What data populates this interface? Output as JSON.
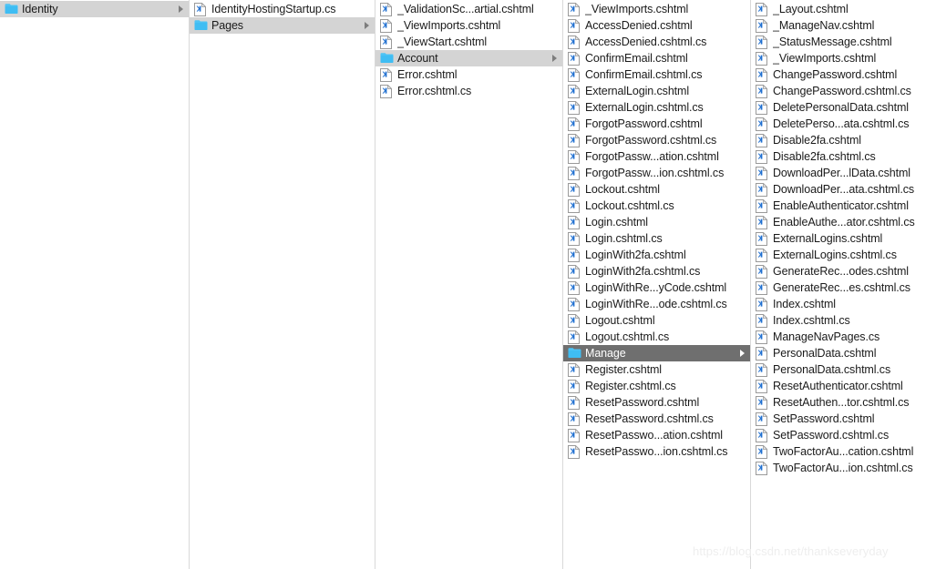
{
  "watermark": "https://blog.csdn.net/thankseveryday",
  "colors": {
    "selection_active_bg": "#6f6f6f",
    "selection_active_text": "#ffffff",
    "selection_inactive_bg": "#d4d4d4",
    "folder_icon": "#55c7f7",
    "file_icon_mark": "#1f6fd0",
    "column_divider": "#d9d9d9",
    "row_text": "#1a1a1a"
  },
  "columns": [
    {
      "name": "column-identity",
      "items": [
        {
          "label": "Identity",
          "icon": "folder-icon",
          "kind": "folder",
          "selected": "inactive",
          "disclosure": true
        }
      ]
    },
    {
      "name": "column-identity-contents",
      "items": [
        {
          "label": "IdentityHostingStartup.cs",
          "icon": "file-icon",
          "kind": "file",
          "selected": "none",
          "disclosure": false
        },
        {
          "label": "Pages",
          "icon": "folder-icon",
          "kind": "folder",
          "selected": "inactive",
          "disclosure": true
        }
      ]
    },
    {
      "name": "column-pages-contents",
      "items": [
        {
          "label": "_ValidationSc...artial.cshtml",
          "icon": "file-icon",
          "kind": "file",
          "selected": "none",
          "disclosure": false
        },
        {
          "label": "_ViewImports.cshtml",
          "icon": "file-icon",
          "kind": "file",
          "selected": "none",
          "disclosure": false
        },
        {
          "label": "_ViewStart.cshtml",
          "icon": "file-icon",
          "kind": "file",
          "selected": "none",
          "disclosure": false
        },
        {
          "label": "Account",
          "icon": "folder-icon",
          "kind": "folder",
          "selected": "inactive",
          "disclosure": true
        },
        {
          "label": "Error.cshtml",
          "icon": "file-icon",
          "kind": "file",
          "selected": "none",
          "disclosure": false
        },
        {
          "label": "Error.cshtml.cs",
          "icon": "file-icon",
          "kind": "file",
          "selected": "none",
          "disclosure": false
        }
      ]
    },
    {
      "name": "column-account-contents",
      "items": [
        {
          "label": "_ViewImports.cshtml",
          "icon": "file-icon",
          "kind": "file",
          "selected": "none",
          "disclosure": false
        },
        {
          "label": "AccessDenied.cshtml",
          "icon": "file-icon",
          "kind": "file",
          "selected": "none",
          "disclosure": false
        },
        {
          "label": "AccessDenied.cshtml.cs",
          "icon": "file-icon",
          "kind": "file",
          "selected": "none",
          "disclosure": false
        },
        {
          "label": "ConfirmEmail.cshtml",
          "icon": "file-icon",
          "kind": "file",
          "selected": "none",
          "disclosure": false
        },
        {
          "label": "ConfirmEmail.cshtml.cs",
          "icon": "file-icon",
          "kind": "file",
          "selected": "none",
          "disclosure": false
        },
        {
          "label": "ExternalLogin.cshtml",
          "icon": "file-icon",
          "kind": "file",
          "selected": "none",
          "disclosure": false
        },
        {
          "label": "ExternalLogin.cshtml.cs",
          "icon": "file-icon",
          "kind": "file",
          "selected": "none",
          "disclosure": false
        },
        {
          "label": "ForgotPassword.cshtml",
          "icon": "file-icon",
          "kind": "file",
          "selected": "none",
          "disclosure": false
        },
        {
          "label": "ForgotPassword.cshtml.cs",
          "icon": "file-icon",
          "kind": "file",
          "selected": "none",
          "disclosure": false
        },
        {
          "label": "ForgotPassw...ation.cshtml",
          "icon": "file-icon",
          "kind": "file",
          "selected": "none",
          "disclosure": false
        },
        {
          "label": "ForgotPassw...ion.cshtml.cs",
          "icon": "file-icon",
          "kind": "file",
          "selected": "none",
          "disclosure": false
        },
        {
          "label": "Lockout.cshtml",
          "icon": "file-icon",
          "kind": "file",
          "selected": "none",
          "disclosure": false
        },
        {
          "label": "Lockout.cshtml.cs",
          "icon": "file-icon",
          "kind": "file",
          "selected": "none",
          "disclosure": false
        },
        {
          "label": "Login.cshtml",
          "icon": "file-icon",
          "kind": "file",
          "selected": "none",
          "disclosure": false
        },
        {
          "label": "Login.cshtml.cs",
          "icon": "file-icon",
          "kind": "file",
          "selected": "none",
          "disclosure": false
        },
        {
          "label": "LoginWith2fa.cshtml",
          "icon": "file-icon",
          "kind": "file",
          "selected": "none",
          "disclosure": false
        },
        {
          "label": "LoginWith2fa.cshtml.cs",
          "icon": "file-icon",
          "kind": "file",
          "selected": "none",
          "disclosure": false
        },
        {
          "label": "LoginWithRe...yCode.cshtml",
          "icon": "file-icon",
          "kind": "file",
          "selected": "none",
          "disclosure": false
        },
        {
          "label": "LoginWithRe...ode.cshtml.cs",
          "icon": "file-icon",
          "kind": "file",
          "selected": "none",
          "disclosure": false
        },
        {
          "label": "Logout.cshtml",
          "icon": "file-icon",
          "kind": "file",
          "selected": "none",
          "disclosure": false
        },
        {
          "label": "Logout.cshtml.cs",
          "icon": "file-icon",
          "kind": "file",
          "selected": "none",
          "disclosure": false
        },
        {
          "label": "Manage",
          "icon": "folder-icon",
          "kind": "folder",
          "selected": "active",
          "disclosure": true
        },
        {
          "label": "Register.cshtml",
          "icon": "file-icon",
          "kind": "file",
          "selected": "none",
          "disclosure": false
        },
        {
          "label": "Register.cshtml.cs",
          "icon": "file-icon",
          "kind": "file",
          "selected": "none",
          "disclosure": false
        },
        {
          "label": "ResetPassword.cshtml",
          "icon": "file-icon",
          "kind": "file",
          "selected": "none",
          "disclosure": false
        },
        {
          "label": "ResetPassword.cshtml.cs",
          "icon": "file-icon",
          "kind": "file",
          "selected": "none",
          "disclosure": false
        },
        {
          "label": "ResetPasswo...ation.cshtml",
          "icon": "file-icon",
          "kind": "file",
          "selected": "none",
          "disclosure": false
        },
        {
          "label": "ResetPasswo...ion.cshtml.cs",
          "icon": "file-icon",
          "kind": "file",
          "selected": "none",
          "disclosure": false
        }
      ]
    },
    {
      "name": "column-manage-contents",
      "items": [
        {
          "label": "_Layout.cshtml",
          "icon": "file-icon",
          "kind": "file",
          "selected": "none",
          "disclosure": false
        },
        {
          "label": "_ManageNav.cshtml",
          "icon": "file-icon",
          "kind": "file",
          "selected": "none",
          "disclosure": false
        },
        {
          "label": "_StatusMessage.cshtml",
          "icon": "file-icon",
          "kind": "file",
          "selected": "none",
          "disclosure": false
        },
        {
          "label": "_ViewImports.cshtml",
          "icon": "file-icon",
          "kind": "file",
          "selected": "none",
          "disclosure": false
        },
        {
          "label": "ChangePassword.cshtml",
          "icon": "file-icon",
          "kind": "file",
          "selected": "none",
          "disclosure": false
        },
        {
          "label": "ChangePassword.cshtml.cs",
          "icon": "file-icon",
          "kind": "file",
          "selected": "none",
          "disclosure": false
        },
        {
          "label": "DeletePersonalData.cshtml",
          "icon": "file-icon",
          "kind": "file",
          "selected": "none",
          "disclosure": false
        },
        {
          "label": "DeletePerso...ata.cshtml.cs",
          "icon": "file-icon",
          "kind": "file",
          "selected": "none",
          "disclosure": false
        },
        {
          "label": "Disable2fa.cshtml",
          "icon": "file-icon",
          "kind": "file",
          "selected": "none",
          "disclosure": false
        },
        {
          "label": "Disable2fa.cshtml.cs",
          "icon": "file-icon",
          "kind": "file",
          "selected": "none",
          "disclosure": false
        },
        {
          "label": "DownloadPer...lData.cshtml",
          "icon": "file-icon",
          "kind": "file",
          "selected": "none",
          "disclosure": false
        },
        {
          "label": "DownloadPer...ata.cshtml.cs",
          "icon": "file-icon",
          "kind": "file",
          "selected": "none",
          "disclosure": false
        },
        {
          "label": "EnableAuthenticator.cshtml",
          "icon": "file-icon",
          "kind": "file",
          "selected": "none",
          "disclosure": false
        },
        {
          "label": "EnableAuthe...ator.cshtml.cs",
          "icon": "file-icon",
          "kind": "file",
          "selected": "none",
          "disclosure": false
        },
        {
          "label": "ExternalLogins.cshtml",
          "icon": "file-icon",
          "kind": "file",
          "selected": "none",
          "disclosure": false
        },
        {
          "label": "ExternalLogins.cshtml.cs",
          "icon": "file-icon",
          "kind": "file",
          "selected": "none",
          "disclosure": false
        },
        {
          "label": "GenerateRec...odes.cshtml",
          "icon": "file-icon",
          "kind": "file",
          "selected": "none",
          "disclosure": false
        },
        {
          "label": "GenerateRec...es.cshtml.cs",
          "icon": "file-icon",
          "kind": "file",
          "selected": "none",
          "disclosure": false
        },
        {
          "label": "Index.cshtml",
          "icon": "file-icon",
          "kind": "file",
          "selected": "none",
          "disclosure": false
        },
        {
          "label": "Index.cshtml.cs",
          "icon": "file-icon",
          "kind": "file",
          "selected": "none",
          "disclosure": false
        },
        {
          "label": "ManageNavPages.cs",
          "icon": "file-icon",
          "kind": "file",
          "selected": "none",
          "disclosure": false
        },
        {
          "label": "PersonalData.cshtml",
          "icon": "file-icon",
          "kind": "file",
          "selected": "none",
          "disclosure": false
        },
        {
          "label": "PersonalData.cshtml.cs",
          "icon": "file-icon",
          "kind": "file",
          "selected": "none",
          "disclosure": false
        },
        {
          "label": "ResetAuthenticator.cshtml",
          "icon": "file-icon",
          "kind": "file",
          "selected": "none",
          "disclosure": false
        },
        {
          "label": "ResetAuthen...tor.cshtml.cs",
          "icon": "file-icon",
          "kind": "file",
          "selected": "none",
          "disclosure": false
        },
        {
          "label": "SetPassword.cshtml",
          "icon": "file-icon",
          "kind": "file",
          "selected": "none",
          "disclosure": false
        },
        {
          "label": "SetPassword.cshtml.cs",
          "icon": "file-icon",
          "kind": "file",
          "selected": "none",
          "disclosure": false
        },
        {
          "label": "TwoFactorAu...cation.cshtml",
          "icon": "file-icon",
          "kind": "file",
          "selected": "none",
          "disclosure": false
        },
        {
          "label": "TwoFactorAu...ion.cshtml.cs",
          "icon": "file-icon",
          "kind": "file",
          "selected": "none",
          "disclosure": false
        }
      ]
    }
  ]
}
